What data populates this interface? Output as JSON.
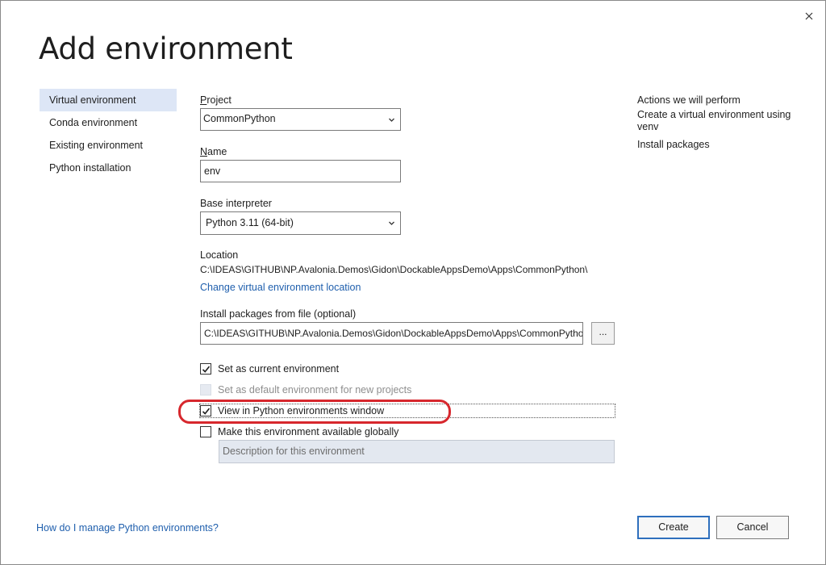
{
  "dialog": {
    "title": "Add environment",
    "close_icon": "close-icon"
  },
  "nav": {
    "items": [
      {
        "label": "Virtual environment",
        "selected": true
      },
      {
        "label": "Conda environment",
        "selected": false
      },
      {
        "label": "Existing environment",
        "selected": false
      },
      {
        "label": "Python installation",
        "selected": false
      }
    ]
  },
  "form": {
    "project": {
      "label": "Project",
      "value": "CommonPython"
    },
    "name": {
      "label": "Name",
      "value": "env"
    },
    "base_interpreter": {
      "label": "Base interpreter",
      "value": "Python 3.11 (64-bit)"
    },
    "location": {
      "label": "Location",
      "path": "C:\\IDEAS\\GITHUB\\NP.Avalonia.Demos\\Gidon\\DockableAppsDemo\\Apps\\CommonPython\\",
      "change_link": "Change virtual environment location"
    },
    "install_packages": {
      "label": "Install packages from file (optional)",
      "value": "C:\\IDEAS\\GITHUB\\NP.Avalonia.Demos\\Gidon\\DockableAppsDemo\\Apps\\CommonPython\\requirements.txt",
      "browse_label": "..."
    },
    "options": {
      "set_current": {
        "label": "Set as current environment",
        "checked": true,
        "enabled": true
      },
      "set_default": {
        "label": "Set as default environment for new projects",
        "checked": false,
        "enabled": false
      },
      "view_in_window": {
        "label": "View in Python environments window",
        "checked": true,
        "enabled": true
      },
      "available_globally": {
        "label": "Make this environment available globally",
        "checked": false,
        "enabled": true
      }
    },
    "description": {
      "placeholder": "Description for this environment"
    }
  },
  "actions": {
    "heading": "Actions we will perform",
    "items": [
      "Create a virtual environment using venv",
      "Install packages"
    ]
  },
  "footer": {
    "help_link": "How do I manage Python environments?",
    "create_label": "Create",
    "cancel_label": "Cancel"
  },
  "colors": {
    "accent": "#1f5fad",
    "selection": "#dde6f6",
    "highlight_annotation": "#d7272d"
  }
}
